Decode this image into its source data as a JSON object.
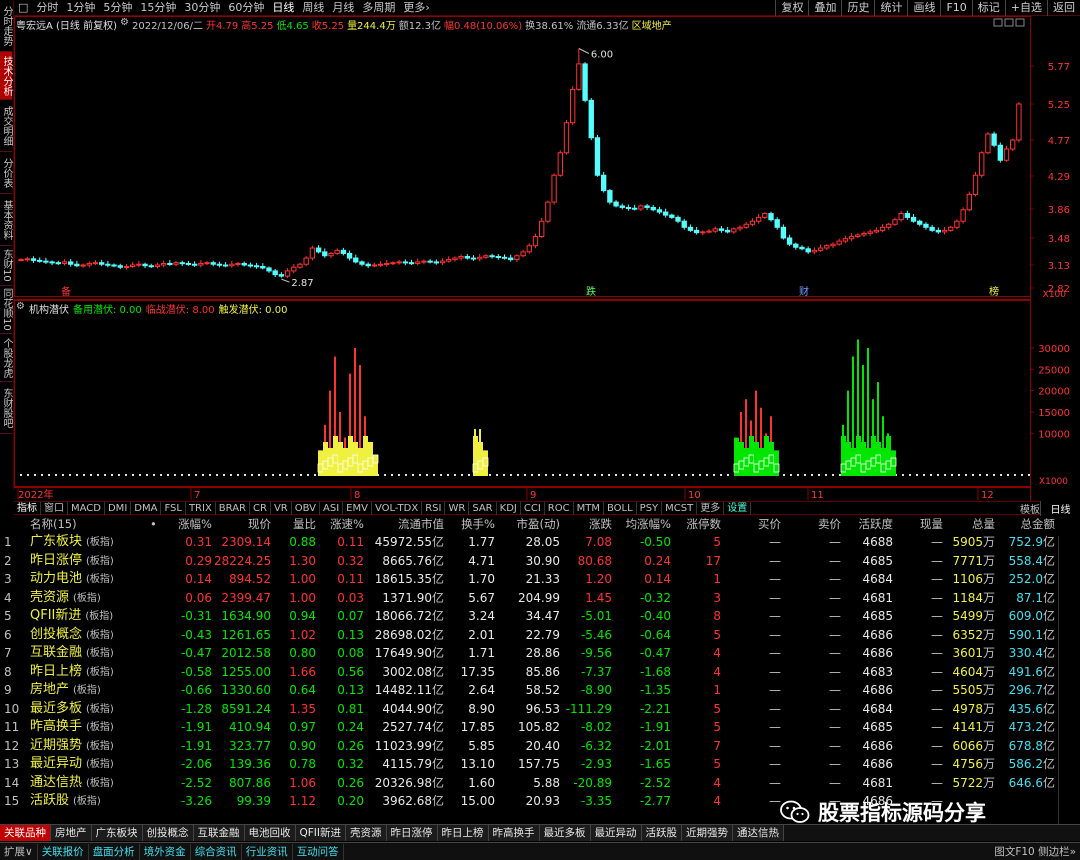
{
  "left_tabs": [
    {
      "label": "分时走势",
      "active": false,
      "h": 52
    },
    {
      "label": "技术分析",
      "active": true,
      "h": 48
    },
    {
      "label": "成交明细",
      "active": false,
      "h": 52
    },
    {
      "label": "分价表",
      "active": false,
      "h": 42
    },
    {
      "label": "基本资料",
      "active": false,
      "h": 52
    },
    {
      "label": "东财10",
      "active": false,
      "h": 40
    },
    {
      "label": "同花顺10",
      "active": false,
      "h": 48
    },
    {
      "label": "个股龙虎",
      "active": false,
      "h": 48
    },
    {
      "label": "东财股吧",
      "active": false,
      "h": 52
    }
  ],
  "toolbar": {
    "periods": [
      "分时",
      "1分钟",
      "5分钟",
      "15分钟",
      "30分钟",
      "60分钟",
      "日线",
      "周线",
      "月线",
      "多周期",
      "更多›"
    ],
    "active_period": "日线",
    "right_buttons": [
      "复权",
      "叠加",
      "历史",
      "统计",
      "画线",
      "F10",
      "标记",
      "+自选",
      "返回"
    ]
  },
  "title": {
    "stock": "粤宏远A (日线 前复权)",
    "date": "2022/12/06/二",
    "open": "开4.79",
    "high": "高5.25",
    "low": "低4.65",
    "close": "收5.25",
    "volume": "量244.4万",
    "amount": "额12.3亿",
    "change": "幅0.48(10.06%)",
    "turnover": "换38.61%",
    "float": "流通6.33亿",
    "region": "区域地产"
  },
  "indicator": {
    "name": "机构潜伏",
    "p1": "备用潜伏: 0.00",
    "p2": "临战潜伏: 8.00",
    "p3": "触发潜伏: 0.00"
  },
  "chart_data": {
    "type": "candlestick",
    "price_axis_ticks": [
      "5.77",
      "5.25",
      "4.77",
      "4.29",
      "3.86",
      "3.48",
      "3.13",
      "2.82"
    ],
    "price_axis_unit": "X100",
    "max_label": "6.00",
    "min_label": "2.87",
    "event_marks": [
      "备",
      "跌",
      "财",
      "榜"
    ],
    "ind_axis_ticks": [
      "30000",
      "25000",
      "20000",
      "15000",
      "10000"
    ],
    "ind_axis_unit": "X1000",
    "month_labels": [
      "2022年",
      "7",
      "8",
      "9",
      "10",
      "11",
      "12"
    ],
    "price_series": [
      3.2,
      3.21,
      3.19,
      3.18,
      3.17,
      3.16,
      3.15,
      3.17,
      3.14,
      3.12,
      3.13,
      3.15,
      3.16,
      3.14,
      3.13,
      3.12,
      3.1,
      3.11,
      3.13,
      3.14,
      3.12,
      3.11,
      3.13,
      3.15,
      3.14,
      3.16,
      3.15,
      3.14,
      3.13,
      3.15,
      3.16,
      3.14,
      3.13,
      3.12,
      3.14,
      3.15,
      3.13,
      3.12,
      3.11,
      3.09,
      3.05,
      3.0,
      2.98,
      3.05,
      3.1,
      3.14,
      3.22,
      3.35,
      3.3,
      3.25,
      3.28,
      3.32,
      3.28,
      3.22,
      3.17,
      3.14,
      3.12,
      3.13,
      3.14,
      3.15,
      3.16,
      3.17,
      3.16,
      3.15,
      3.17,
      3.18,
      3.17,
      3.16,
      3.18,
      3.2,
      3.22,
      3.24,
      3.22,
      3.21,
      3.23,
      3.25,
      3.24,
      3.23,
      3.22,
      3.2,
      3.25,
      3.3,
      3.38,
      3.5,
      3.7,
      3.95,
      4.3,
      4.6,
      5.0,
      5.45,
      5.8,
      5.3,
      4.8,
      4.3,
      4.1,
      3.95,
      3.9,
      3.88,
      3.87,
      3.86,
      3.9,
      3.88,
      3.85,
      3.82,
      3.78,
      3.75,
      3.7,
      3.62,
      3.58,
      3.55,
      3.56,
      3.57,
      3.6,
      3.58,
      3.56,
      3.6,
      3.62,
      3.66,
      3.7,
      3.75,
      3.8,
      3.72,
      3.62,
      3.48,
      3.4,
      3.36,
      3.34,
      3.3,
      3.32,
      3.35,
      3.38,
      3.4,
      3.44,
      3.47,
      3.5,
      3.52,
      3.54,
      3.56,
      3.58,
      3.62,
      3.66,
      3.72,
      3.8,
      3.75,
      3.7,
      3.66,
      3.62,
      3.58,
      3.56,
      3.58,
      3.62,
      3.7,
      3.85,
      4.05,
      4.3,
      4.6,
      4.85,
      4.7,
      4.5,
      4.65,
      4.77,
      5.25
    ]
  },
  "indicator_tabs": [
    "指标",
    "窗口",
    "MACD",
    "DMI",
    "DMA",
    "FSL",
    "TRIX",
    "BRAR",
    "CR",
    "VR",
    "OBV",
    "ASI",
    "EMV",
    "VOL-TDX",
    "RSI",
    "WR",
    "SAR",
    "KDJ",
    "CCI",
    "ROC",
    "MTM",
    "BOLL",
    "PSY",
    "MCST",
    "更多",
    "设置"
  ],
  "indicator_tabs_right": {
    "template": "模板",
    "period": "日线"
  },
  "table": {
    "headers": [
      "名称(15)",
      "涨幅%",
      "现价",
      "量比",
      "涨速%",
      "流通市值",
      "换手%",
      "市盈(动)",
      "涨跌",
      "均涨幅%",
      "涨停数",
      "买价",
      "卖价",
      "活跃度",
      "现量",
      "总量",
      "总金额"
    ],
    "rows": [
      {
        "idx": "1",
        "name": "广东板块",
        "tag": "(板指)",
        "zf": "0.31",
        "xj": "2309.14",
        "lb": "0.88",
        "zs": "0.11",
        "ltsz": "45972.55",
        "hs": "1.77",
        "syl": "28.05",
        "zd": "7.08",
        "jzf": "-0.50",
        "zts": "5",
        "mj": "—",
        "mcj": "—",
        "hyd": "4688",
        "xl": "—",
        "zl": "5905",
        "zje": "752.9"
      },
      {
        "idx": "2",
        "name": "昨日涨停",
        "tag": "(板指)",
        "zf": "0.29",
        "xj": "28224.25",
        "lb": "1.30",
        "zs": "0.32",
        "ltsz": "8665.76",
        "hs": "4.71",
        "syl": "30.90",
        "zd": "80.68",
        "jzf": "0.24",
        "zts": "17",
        "mj": "—",
        "mcj": "—",
        "hyd": "4685",
        "xl": "—",
        "zl": "7771",
        "zje": "558.4"
      },
      {
        "idx": "3",
        "name": "动力电池",
        "tag": "(板指)",
        "zf": "0.14",
        "xj": "894.52",
        "lb": "1.00",
        "zs": "0.11",
        "ltsz": "18615.35",
        "hs": "1.70",
        "syl": "21.33",
        "zd": "1.20",
        "jzf": "0.14",
        "zts": "1",
        "mj": "—",
        "mcj": "—",
        "hyd": "4684",
        "xl": "—",
        "zl": "1106",
        "zje": "252.0"
      },
      {
        "idx": "4",
        "name": "壳资源",
        "tag": "(板指)",
        "zf": "0.06",
        "xj": "2399.47",
        "lb": "1.00",
        "zs": "0.03",
        "ltsz": "1371.90",
        "hs": "5.67",
        "syl": "204.99",
        "zd": "1.45",
        "jzf": "-0.32",
        "zts": "3",
        "mj": "—",
        "mcj": "—",
        "hyd": "4681",
        "xl": "—",
        "zl": "1184",
        "zje": "87.1"
      },
      {
        "idx": "5",
        "name": "QFII新进",
        "tag": "(板指)",
        "zf": "-0.31",
        "xj": "1634.90",
        "lb": "0.94",
        "zs": "0.07",
        "ltsz": "18066.72",
        "hs": "3.24",
        "syl": "34.47",
        "zd": "-5.01",
        "jzf": "-0.40",
        "zts": "8",
        "mj": "—",
        "mcj": "—",
        "hyd": "4685",
        "xl": "—",
        "zl": "5499",
        "zje": "609.0"
      },
      {
        "idx": "6",
        "name": "创投概念",
        "tag": "(板指)",
        "zf": "-0.43",
        "xj": "1261.65",
        "lb": "1.02",
        "zs": "0.13",
        "ltsz": "28698.02",
        "hs": "2.01",
        "syl": "22.79",
        "zd": "-5.46",
        "jzf": "-0.64",
        "zts": "5",
        "mj": "—",
        "mcj": "—",
        "hyd": "4686",
        "xl": "—",
        "zl": "6352",
        "zje": "590.1"
      },
      {
        "idx": "7",
        "name": "互联金融",
        "tag": "(板指)",
        "zf": "-0.47",
        "xj": "2012.58",
        "lb": "0.80",
        "zs": "0.08",
        "ltsz": "17649.90",
        "hs": "1.71",
        "syl": "28.86",
        "zd": "-9.56",
        "jzf": "-0.47",
        "zts": "4",
        "mj": "—",
        "mcj": "—",
        "hyd": "4686",
        "xl": "—",
        "zl": "3601",
        "zje": "330.4"
      },
      {
        "idx": "8",
        "name": "昨日上榜",
        "tag": "(板指)",
        "zf": "-0.58",
        "xj": "1255.00",
        "lb": "1.66",
        "zs": "0.56",
        "ltsz": "3002.08",
        "hs": "17.35",
        "syl": "85.86",
        "zd": "-7.37",
        "jzf": "-1.68",
        "zts": "4",
        "mj": "—",
        "mcj": "—",
        "hyd": "4683",
        "xl": "—",
        "zl": "4604",
        "zje": "491.6"
      },
      {
        "idx": "9",
        "name": "房地产",
        "tag": "(板指)",
        "zf": "-0.66",
        "xj": "1330.60",
        "lb": "0.64",
        "zs": "0.13",
        "ltsz": "14482.11",
        "hs": "2.64",
        "syl": "58.52",
        "zd": "-8.90",
        "jzf": "-1.35",
        "zts": "1",
        "mj": "—",
        "mcj": "—",
        "hyd": "4686",
        "xl": "—",
        "zl": "5505",
        "zje": "296.7"
      },
      {
        "idx": "10",
        "name": "最近多板",
        "tag": "(板指)",
        "zf": "-1.28",
        "xj": "8591.24",
        "lb": "1.35",
        "zs": "0.81",
        "ltsz": "4044.90",
        "hs": "8.90",
        "syl": "96.53",
        "zd": "-111.29",
        "jzf": "-2.21",
        "zts": "5",
        "mj": "—",
        "mcj": "—",
        "hyd": "4684",
        "xl": "—",
        "zl": "4978",
        "zje": "435.6"
      },
      {
        "idx": "11",
        "name": "昨高换手",
        "tag": "(板指)",
        "zf": "-1.91",
        "xj": "410.94",
        "lb": "0.97",
        "zs": "0.24",
        "ltsz": "2527.74",
        "hs": "17.85",
        "syl": "105.82",
        "zd": "-8.02",
        "jzf": "-1.91",
        "zts": "5",
        "mj": "—",
        "mcj": "—",
        "hyd": "4685",
        "xl": "—",
        "zl": "4141",
        "zje": "473.2"
      },
      {
        "idx": "12",
        "name": "近期强势",
        "tag": "(板指)",
        "zf": "-1.91",
        "xj": "323.77",
        "lb": "0.90",
        "zs": "0.26",
        "ltsz": "11023.99",
        "hs": "5.85",
        "syl": "20.40",
        "zd": "-6.32",
        "jzf": "-2.01",
        "zts": "7",
        "mj": "—",
        "mcj": "—",
        "hyd": "4686",
        "xl": "—",
        "zl": "6066",
        "zje": "678.8"
      },
      {
        "idx": "13",
        "name": "最近异动",
        "tag": "(板指)",
        "zf": "-2.06",
        "xj": "139.36",
        "lb": "0.78",
        "zs": "0.32",
        "ltsz": "4115.79",
        "hs": "13.10",
        "syl": "157.75",
        "zd": "-2.93",
        "jzf": "-1.65",
        "zts": "5",
        "mj": "—",
        "mcj": "—",
        "hyd": "4686",
        "xl": "—",
        "zl": "4756",
        "zje": "586.2"
      },
      {
        "idx": "14",
        "name": "通达信热",
        "tag": "(板指)",
        "zf": "-2.52",
        "xj": "807.86",
        "lb": "1.06",
        "zs": "0.26",
        "ltsz": "20326.98",
        "hs": "1.60",
        "syl": "5.88",
        "zd": "-20.89",
        "jzf": "-2.52",
        "zts": "4",
        "mj": "—",
        "mcj": "—",
        "hyd": "4681",
        "xl": "—",
        "zl": "5722",
        "zje": "646.6"
      },
      {
        "idx": "15",
        "name": "活跃股",
        "tag": "(板指)",
        "zf": "-3.26",
        "xj": "99.39",
        "lb": "1.12",
        "zs": "0.20",
        "ltsz": "3962.68",
        "hs": "15.00",
        "syl": "20.93",
        "zd": "-3.35",
        "jzf": "-2.77",
        "zts": "4",
        "mj": "—",
        "mcj": "—",
        "hyd": "4686",
        "xl": "—",
        "zl": "",
        "zje": ""
      }
    ],
    "units": {
      "ltsz": "亿",
      "zl": "万",
      "zje": "亿"
    }
  },
  "bottom_tabs": [
    "关联品种",
    "房地产",
    "广东板块",
    "创投概念",
    "互联金融",
    "电池回收",
    "QFII新进",
    "壳资源",
    "昨日涨停",
    "昨日上榜",
    "昨高换手",
    "最近多板",
    "最近异动",
    "活跃股",
    "近期强势",
    "通达信热"
  ],
  "status_bar": {
    "items": [
      "扩展∨",
      "关联报价",
      "盘面分析",
      "境外资金",
      "综合资讯",
      "行业资讯",
      "互动问答"
    ],
    "right": "图文F10  侧边栏»"
  },
  "watermark": "股票指标源码分享",
  "colors": {
    "up": "#ff3232",
    "down": "#00e600",
    "cyan": "#54ffff",
    "yellow": "#f0f040",
    "panel_border": "#8b0000"
  }
}
